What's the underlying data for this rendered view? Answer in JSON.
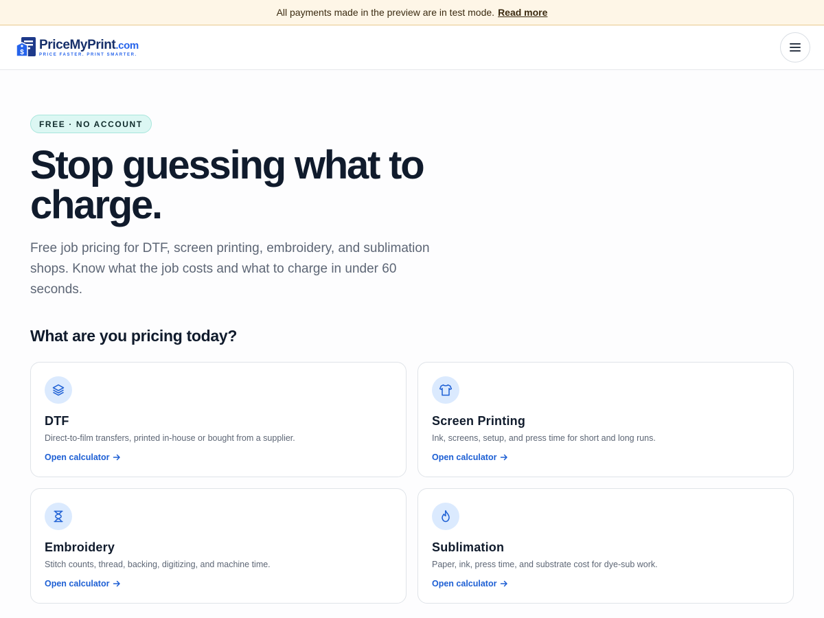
{
  "banner": {
    "text": "All payments made in the preview are in test mode.",
    "link": "Read more"
  },
  "header": {
    "logo_name": "PriceMyPrint",
    "logo_suffix": ".com",
    "logo_tagline": "PRICE FASTER. PRINT SMARTER.",
    "menu_icon": "hamburger-icon"
  },
  "hero": {
    "badge": "FREE · NO ACCOUNT",
    "title": "Stop guessing what to charge.",
    "subtitle": "Free job pricing for DTF, screen printing, embroidery, and sublimation shops. Know what the job costs and what to charge in under 60 seconds."
  },
  "section": {
    "title": "What are you pricing today?"
  },
  "cards": [
    {
      "title": "DTF",
      "description": "Direct-to-film transfers, printed in-house or bought from a supplier.",
      "link": "Open calculator",
      "icon": "layers-icon"
    },
    {
      "title": "Screen Printing",
      "description": "Ink, screens, setup, and press time for short and long runs.",
      "link": "Open calculator",
      "icon": "shirt-icon"
    },
    {
      "title": "Embroidery",
      "description": "Stitch counts, thread, backing, digitizing, and machine time.",
      "link": "Open calculator",
      "icon": "spool-icon"
    },
    {
      "title": "Sublimation",
      "description": "Paper, ink, press time, and substrate cost for dye-sub work.",
      "link": "Open calculator",
      "icon": "flame-icon"
    }
  ],
  "colors": {
    "banner_bg": "#fef6e7",
    "accent": "#1d5fd4",
    "badge_bg": "#dcf7f3",
    "icon_bg": "#dbeafe",
    "heading": "#101b2c"
  }
}
